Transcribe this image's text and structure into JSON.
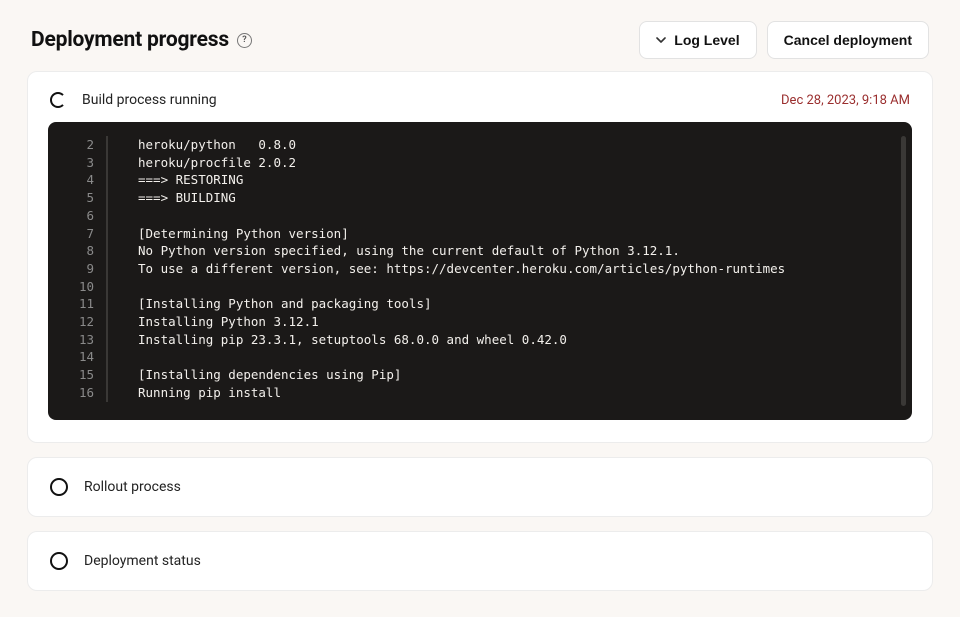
{
  "header": {
    "title": "Deployment progress",
    "help_tooltip": "?",
    "log_level_label": "Log Level",
    "cancel_label": "Cancel deployment"
  },
  "build": {
    "title": "Build process running",
    "timestamp": "Dec 28, 2023, 9:18 AM",
    "lines": [
      {
        "n": "2",
        "t": "heroku/python   0.8.0"
      },
      {
        "n": "3",
        "t": "heroku/procfile 2.0.2"
      },
      {
        "n": "4",
        "t": "===> RESTORING"
      },
      {
        "n": "5",
        "t": "===> BUILDING"
      },
      {
        "n": "6",
        "t": ""
      },
      {
        "n": "7",
        "t": "[Determining Python version]"
      },
      {
        "n": "8",
        "t": "No Python version specified, using the current default of Python 3.12.1."
      },
      {
        "n": "9",
        "t": "To use a different version, see: https://devcenter.heroku.com/articles/python-runtimes"
      },
      {
        "n": "10",
        "t": ""
      },
      {
        "n": "11",
        "t": "[Installing Python and packaging tools]"
      },
      {
        "n": "12",
        "t": "Installing Python 3.12.1"
      },
      {
        "n": "13",
        "t": "Installing pip 23.3.1, setuptools 68.0.0 and wheel 0.42.0"
      },
      {
        "n": "14",
        "t": ""
      },
      {
        "n": "15",
        "t": "[Installing dependencies using Pip]"
      },
      {
        "n": "16",
        "t": "Running pip install"
      }
    ]
  },
  "rollout": {
    "title": "Rollout process"
  },
  "status": {
    "title": "Deployment status"
  }
}
